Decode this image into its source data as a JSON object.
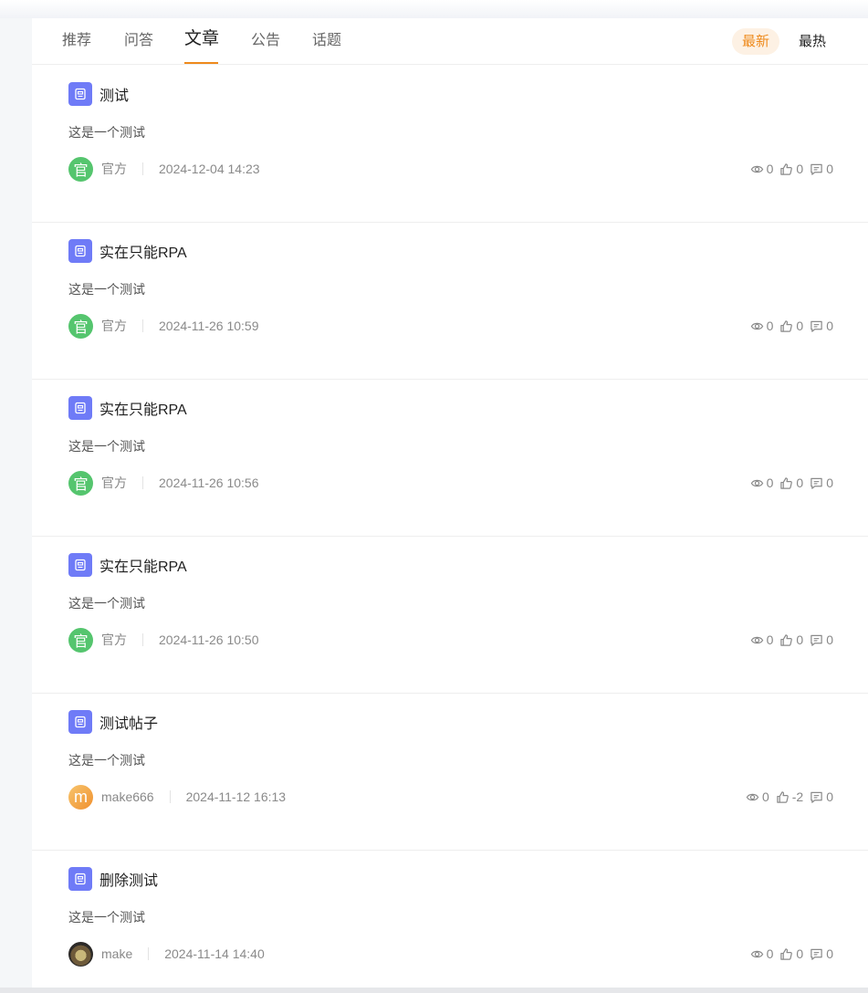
{
  "tabs": [
    "推荐",
    "问答",
    "文章",
    "公告",
    "话题"
  ],
  "active_tab": "文章",
  "sort": {
    "latest": "最新",
    "hot": "最热"
  },
  "colors": {
    "accent": "#ee8a1c",
    "doc_icon": "#6f7bf7",
    "official_avatar": "#55c56e"
  },
  "posts": [
    {
      "title": "测试",
      "desc": "这是一个测试",
      "avatar_text": "官",
      "author": "官方",
      "time": "2024-12-04 14:23",
      "views": "0",
      "likes": "0",
      "comments": "0"
    },
    {
      "title": "实在只能RPA",
      "desc": "这是一个测试",
      "avatar_text": "官",
      "author": "官方",
      "time": "2024-11-26 10:59",
      "views": "0",
      "likes": "0",
      "comments": "0"
    },
    {
      "title": "实在只能RPA",
      "desc": "这是一个测试",
      "avatar_text": "官",
      "author": "官方",
      "time": "2024-11-26 10:56",
      "views": "0",
      "likes": "0",
      "comments": "0"
    },
    {
      "title": "实在只能RPA",
      "desc": "这是一个测试",
      "avatar_text": "官",
      "author": "官方",
      "time": "2024-11-26 10:50",
      "views": "0",
      "likes": "0",
      "comments": "0"
    },
    {
      "title": "测试帖子",
      "desc": "这是一个测试",
      "avatar_text": "m",
      "author": "make666",
      "time": "2024-11-12 16:13",
      "views": "0",
      "likes": "-2",
      "comments": "0"
    },
    {
      "title": "删除测试",
      "desc": "这是一个测试",
      "avatar_text": "",
      "author": "make",
      "time": "2024-11-14 14:40",
      "views": "0",
      "likes": "0",
      "comments": "0"
    }
  ]
}
